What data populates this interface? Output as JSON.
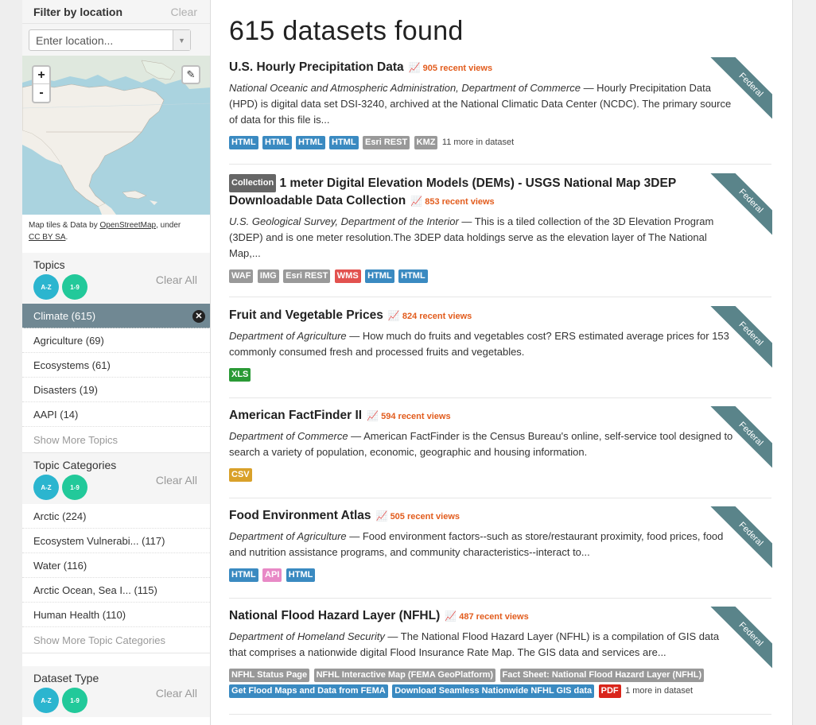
{
  "sidebar": {
    "location": {
      "title": "Filter by location",
      "clear": "Clear",
      "placeholder": "Enter location...",
      "dropdown_icon": "chevron-down-icon"
    },
    "map": {
      "zoom_in": "+",
      "zoom_out": "-",
      "attribution_prefix": "Map tiles & Data by ",
      "attribution_link": "OpenStreetMap",
      "attribution_mid": ", under ",
      "license_link": "CC BY SA",
      "attribution_end": "."
    },
    "sorters": {
      "az": "A-Z",
      "num": "1-9"
    },
    "topics": {
      "title": "Topics",
      "clear": "Clear All",
      "items": [
        {
          "label": "Climate (615)",
          "active": true
        },
        {
          "label": "Agriculture (69)"
        },
        {
          "label": "Ecosystems (61)"
        },
        {
          "label": "Disasters (19)"
        },
        {
          "label": "AAPI (14)"
        }
      ],
      "show_more": "Show More Topics"
    },
    "topic_categories": {
      "title": "Topic Categories",
      "clear": "Clear All",
      "items": [
        {
          "label": "Arctic (224)"
        },
        {
          "label": "Ecosystem Vulnerabi... (117)"
        },
        {
          "label": "Water (116)"
        },
        {
          "label": "Arctic Ocean, Sea I... (115)"
        },
        {
          "label": "Human Health (110)"
        }
      ],
      "show_more": "Show More Topic Categories"
    },
    "dataset_type": {
      "title": "Dataset Type",
      "clear": "Clear All"
    }
  },
  "main": {
    "heading": "615 datasets found",
    "ribbon_label": "Federal",
    "format_colors": {
      "HTML": "#3a8ac1",
      "Esri REST": "#999999",
      "KMZ": "#999999",
      "WAF": "#999999",
      "IMG": "#999999",
      "WMS": "#e2524f",
      "XLS": "#2a9a36",
      "CSV": "#d9a12a",
      "API": "#e889c6",
      "PDF": "#d9251b",
      "GREY": "#999999",
      "BLUE": "#3a8ac1"
    },
    "datasets": [
      {
        "title": "U.S. Hourly Precipitation Data",
        "views": "905 recent views",
        "org": "National Oceanic and Atmospheric Administration, Department of Commerce",
        "desc": " — Hourly Precipitation Data (HPD) is digital data set DSI-3240, archived at the National Climatic Data Center (NCDC). The primary source of data for this file is...",
        "formats": [
          "HTML",
          "HTML",
          "HTML",
          "HTML",
          "Esri REST",
          "KMZ"
        ],
        "more": "11 more in dataset"
      },
      {
        "collection": "Collection",
        "title": "1 meter Digital Elevation Models (DEMs) - USGS National Map 3DEP Downloadable Data Collection",
        "views": "853 recent views",
        "org": "U.S. Geological Survey, Department of the Interior",
        "desc": " — This is a tiled collection of the 3D Elevation Program (3DEP) and is one meter resolution.The 3DEP data holdings serve as the elevation layer of The National Map,...",
        "formats": [
          "WAF",
          "IMG",
          "Esri REST",
          "WMS",
          "HTML",
          "HTML"
        ]
      },
      {
        "title": "Fruit and Vegetable Prices",
        "views": "824 recent views",
        "org": "Department of Agriculture",
        "desc": " — How much do fruits and vegetables cost? ERS estimated average prices for 153 commonly consumed fresh and processed fruits and vegetables.",
        "formats": [
          "XLS"
        ]
      },
      {
        "title": "American FactFinder II",
        "views": "594 recent views",
        "org": "Department of Commerce",
        "desc": " — American FactFinder is the Census Bureau's online, self-service tool designed to search a variety of population, economic, geographic and housing information.",
        "formats": [
          "CSV"
        ]
      },
      {
        "title": "Food Environment Atlas",
        "views": "505 recent views",
        "org": "Department of Agriculture",
        "desc": " — Food environment factors--such as store/restaurant proximity, food prices, food and nutrition assistance programs, and community characteristics--interact to...",
        "formats": [
          "HTML",
          "API",
          "HTML"
        ]
      },
      {
        "title": "National Flood Hazard Layer (NFHL)",
        "views": "487 recent views",
        "org": "Department of Homeland Security",
        "desc": " — The National Flood Hazard Layer (NFHL) is a compilation of GIS data that comprises a nationwide digital Flood Insurance Rate Map. The GIS data and services are...",
        "formats": [
          "NFHL Status Page",
          "NFHL Interactive Map (FEMA GeoPlatform)",
          "Fact Sheet: National Flood Hazard Layer (NFHL)",
          "Get Flood Maps and Data from FEMA",
          "Download Seamless Nationwide NFHL GIS data",
          "PDF"
        ],
        "format_color_keys": [
          "GREY",
          "GREY",
          "GREY",
          "BLUE",
          "BLUE",
          "PDF"
        ],
        "more": "1 more in dataset"
      }
    ]
  }
}
